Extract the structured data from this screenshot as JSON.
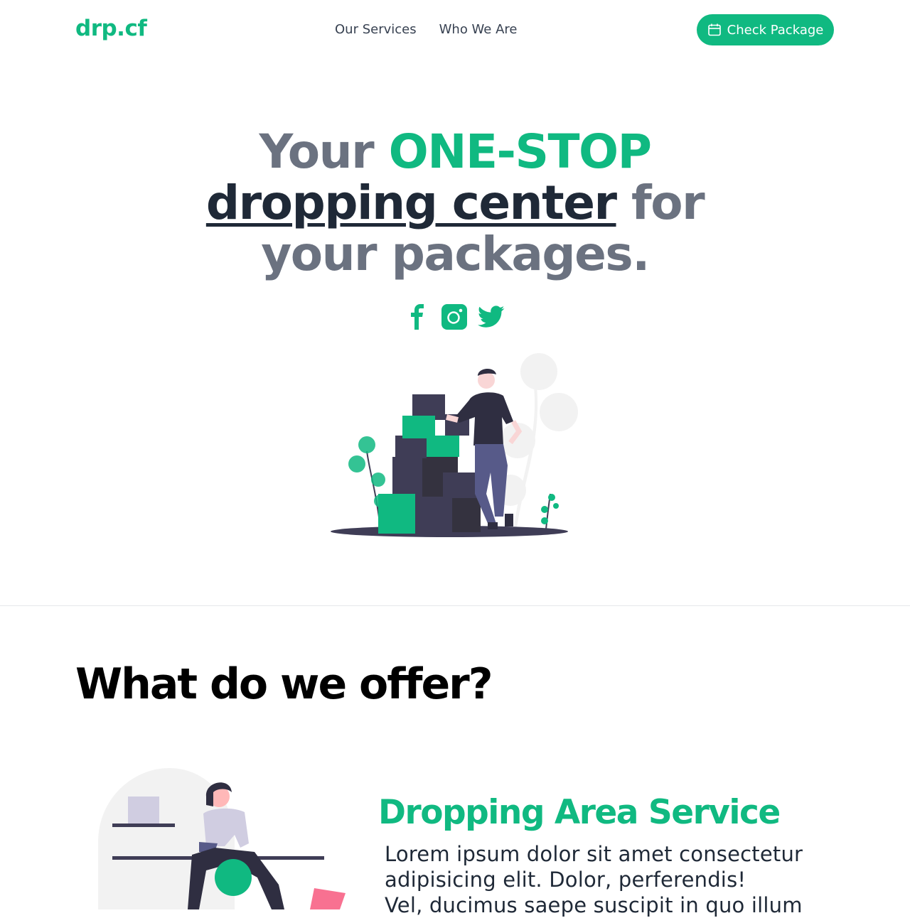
{
  "navbar": {
    "logo": "drp.cf",
    "links": [
      "Our Services",
      "Who We Are"
    ],
    "cta_label": "Check Package"
  },
  "hero": {
    "title_word_1": "Your",
    "title_accent": "ONE-STOP",
    "title_underlined": "dropping center",
    "title_word_2": "for",
    "title_line_3": "your packages.",
    "social_icons": [
      "facebook-icon",
      "instagram-icon",
      "twitter-icon"
    ]
  },
  "offer": {
    "heading": "What do we offer?",
    "service": {
      "title": "Dropping Area Service",
      "lines": [
        "Lorem ipsum dolor sit amet consectetur",
        "adipisicing elit. Dolor, perferendis!",
        "Vel, ducimus saepe suscipit in quo illum"
      ]
    }
  },
  "colors": {
    "accent": "#10b981",
    "heading_gray": "#6b7280",
    "dark": "#1f2937",
    "illustration_dark": "#3f3d56",
    "illustration_pink": "#f87191"
  }
}
